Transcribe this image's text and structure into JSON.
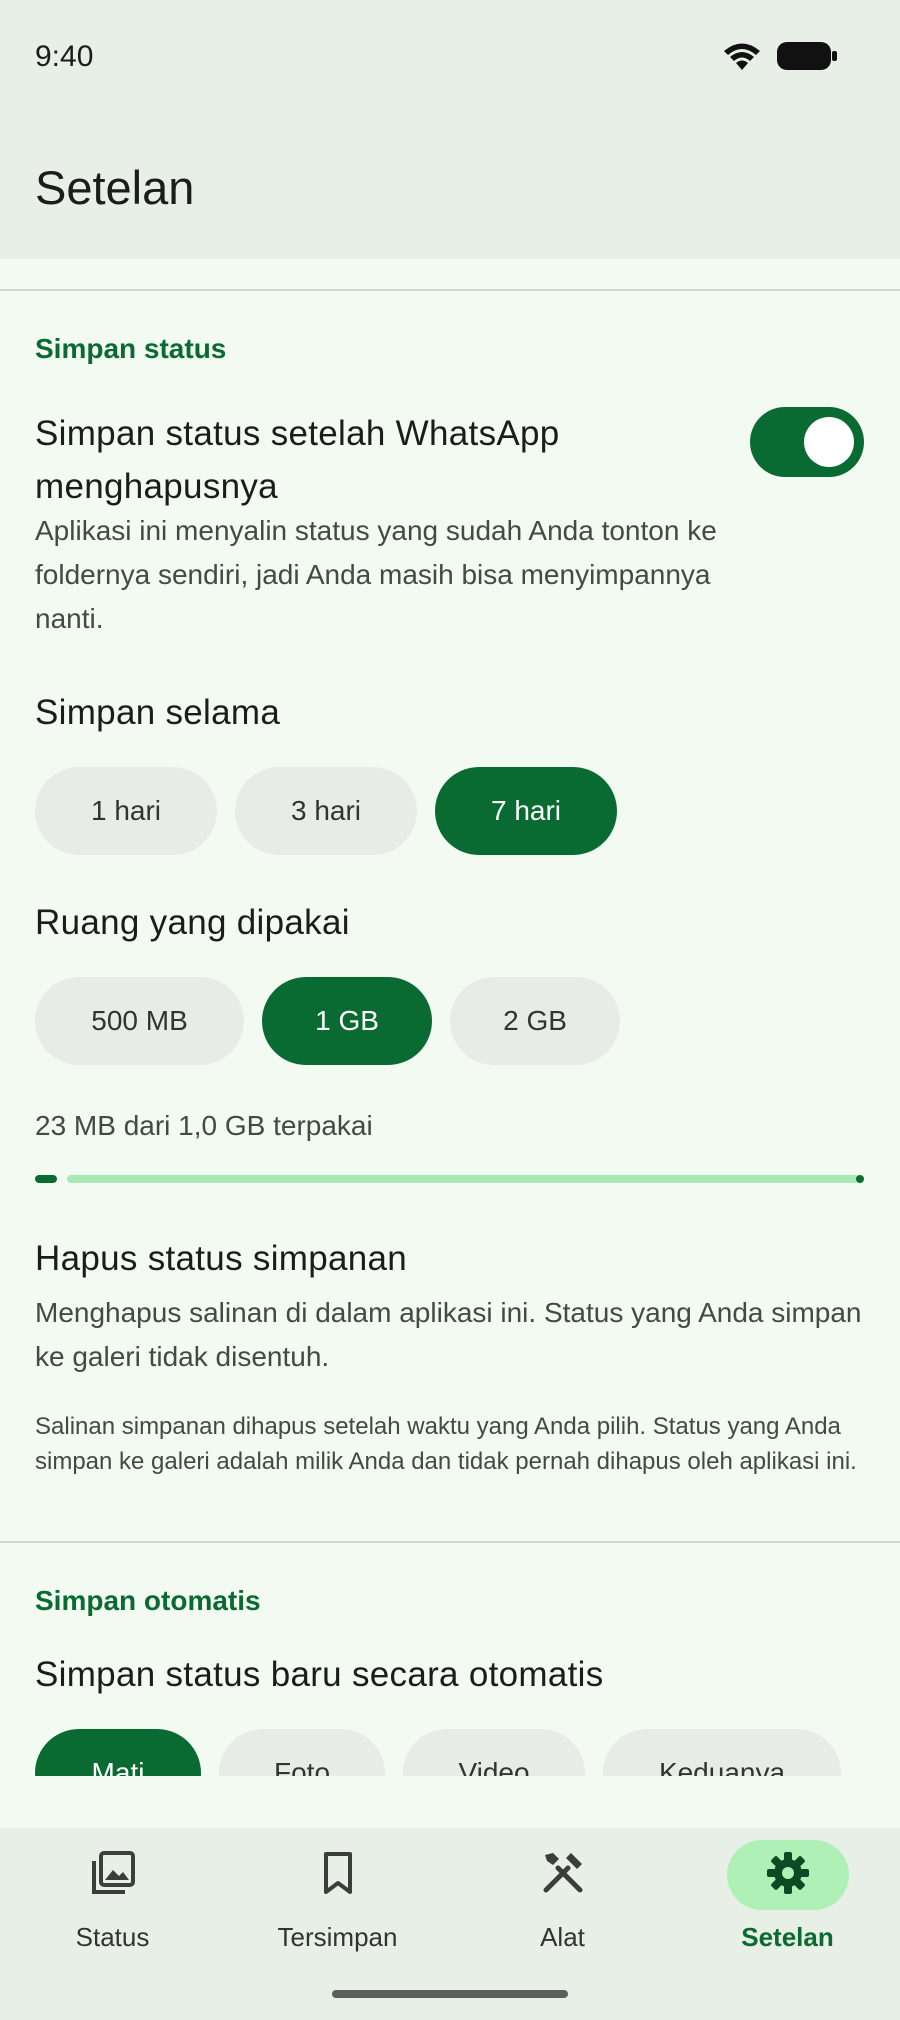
{
  "status_bar": {
    "time": "9:40"
  },
  "top_bar": {
    "title": "Setelan"
  },
  "section_save": {
    "header": "Simpan status",
    "keep_after_delete": {
      "title": "Simpan status setelah WhatsApp menghapusnya",
      "description": "Aplikasi ini menyalin status yang sudah Anda tonton ke foldernya sendiri, jadi Anda masih bisa menyimpannya nanti.",
      "enabled": true
    },
    "duration": {
      "title": "Simpan selama",
      "options": [
        "1 hari",
        "3 hari",
        "7 hari"
      ],
      "selected": "7 hari"
    },
    "storage": {
      "title": "Ruang yang dipakai",
      "options": [
        "500 MB",
        "1 GB",
        "2 GB"
      ],
      "selected": "1 GB",
      "usage_text": "23 MB dari 1,0 GB terpakai",
      "used_fraction": 0.023
    },
    "clear": {
      "title": "Hapus status simpanan",
      "description": "Menghapus salinan di dalam aplikasi ini. Status yang Anda simpan ke galeri tidak disentuh."
    },
    "footnote": "Salinan simpanan dihapus setelah waktu yang Anda pilih. Status yang Anda simpan ke galeri adalah milik Anda dan tidak pernah dihapus oleh aplikasi ini."
  },
  "section_auto": {
    "header": "Simpan otomatis",
    "title": "Simpan status baru secara otomatis",
    "options": [
      "Mati",
      "Foto",
      "Video",
      "Keduanya"
    ],
    "selected": "Mati"
  },
  "bottom_nav": {
    "items": [
      {
        "label": "Status",
        "icon": "photo-library-icon"
      },
      {
        "label": "Tersimpan",
        "icon": "bookmark-icon"
      },
      {
        "label": "Alat",
        "icon": "tools-icon"
      },
      {
        "label": "Setelan",
        "icon": "gear-icon"
      }
    ],
    "active": "Setelan"
  },
  "colors": {
    "accent": "#0a6b32",
    "accent_light": "#a9e8b4",
    "nav_active_pill": "#aff0b6",
    "surface": "#f3faf1",
    "top_surface": "#e8efe6",
    "chip_bg": "#e8ece6"
  }
}
